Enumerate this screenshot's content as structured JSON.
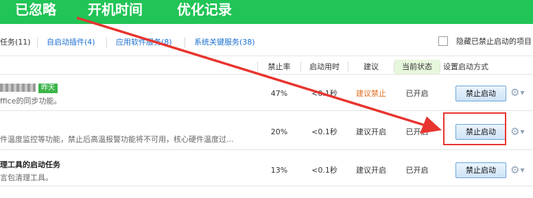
{
  "topnav": {
    "items": [
      "已忽略",
      "开机时间",
      "优化记录"
    ],
    "color": "#21c456"
  },
  "subtabs": [
    {
      "label": "任务(11)"
    },
    {
      "label": "自启动插件(4)"
    },
    {
      "label": "应用软件服务(8)"
    },
    {
      "label": "系统关键服务(38)"
    }
  ],
  "hide_disabled": {
    "label": "隐藏已禁止启动的项目",
    "checked": false
  },
  "table": {
    "columns": [
      "禁止率",
      "启动用时",
      "建议",
      "当前状态",
      "设置启动方式"
    ],
    "rows": [
      {
        "name": "",
        "badge": "昨天",
        "desc": "ffice的同步功能。",
        "rate": "47%",
        "time": "<0.1秒",
        "suggest": "建议禁止",
        "status": "已开启",
        "action": "禁止启动"
      },
      {
        "name": "",
        "badge": "",
        "desc": "件温度监控等功能，禁止后高温报警功能将不可用，核心硬件温度过...",
        "rate": "20%",
        "time": "<0.1秒",
        "suggest": "建议开启",
        "status": "已开启",
        "action": "禁止启动"
      },
      {
        "name": "理工具的启动任务",
        "badge": "",
        "desc": "言包清理工具。",
        "rate": "13%",
        "time": "<0.1秒",
        "suggest": "建议开启",
        "status": "已开启",
        "action": "禁止启动"
      }
    ]
  },
  "colors": {
    "accent": "#21c456",
    "link": "#1a6fd0",
    "warn": "#e06d1d",
    "annotation": "#e8342e"
  },
  "icons": [
    "gear-icon",
    "chevron-down-icon"
  ]
}
